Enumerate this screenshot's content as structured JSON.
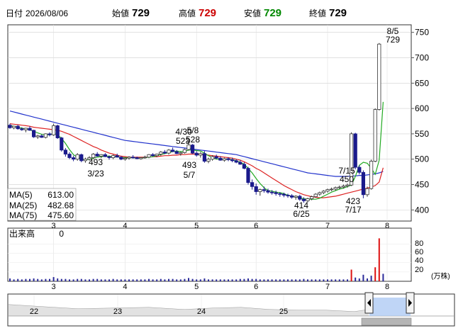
{
  "header": {
    "date_label": "日付",
    "date_value": "2026/08/06",
    "open_label": "始値",
    "open_value": "729",
    "high_label": "高値",
    "high_value": "729",
    "low_label": "安値",
    "low_value": "729",
    "close_label": "終値",
    "close_value": "729"
  },
  "colors": {
    "up": "#ffffff",
    "down": "#1a1a8c",
    "ma5": "#22aa22",
    "ma25": "#dd2222",
    "ma75": "#2233cc",
    "volume": "#2a2a9a",
    "volume_hi": "#dd1111",
    "high_value": "#cc0000",
    "low_value": "#008800"
  },
  "legend": {
    "ma5": "MA(5)",
    "ma5_value": "613.00",
    "ma25": "MA(25)",
    "ma25_value": "482.68",
    "ma75": "MA(75)",
    "ma75_value": "475.60"
  },
  "volume_panel": {
    "label": "出来高",
    "value": "0",
    "unit": "(万株)",
    "ticks": [
      "80",
      "60",
      "40",
      "20"
    ]
  },
  "chart_data": {
    "type": "candlestick",
    "ylim": [
      378,
      765
    ],
    "yticks": [
      400,
      450,
      500,
      550,
      600,
      650,
      700,
      750
    ],
    "xticks": [
      "3",
      "4",
      "5",
      "6",
      "7",
      "8"
    ],
    "navigator_ticks": [
      "22",
      "23",
      "24",
      "25"
    ],
    "annotations": [
      {
        "text": "4/30",
        "value": 535
      },
      {
        "text": "5/8",
        "value": 528
      },
      {
        "text": "523",
        "value": 523
      },
      {
        "text": "528",
        "value": 528
      },
      {
        "text": "493",
        "value": 493
      },
      {
        "text": "3/23",
        "value": 493
      },
      {
        "text": "493",
        "value": 493
      },
      {
        "text": "5/7",
        "value": 493
      },
      {
        "text": "414",
        "value": 414
      },
      {
        "text": "6/25",
        "value": 414
      },
      {
        "text": "7/15",
        "value": 450
      },
      {
        "text": "450",
        "value": 450
      },
      {
        "text": "423",
        "value": 423
      },
      {
        "text": "7/17",
        "value": 423
      },
      {
        "text": "8/5",
        "value": 729
      },
      {
        "text": "729",
        "value": 729
      }
    ],
    "candles": [
      [
        567,
        570,
        560,
        562
      ],
      [
        562,
        566,
        559,
        565
      ],
      [
        565,
        568,
        558,
        560
      ],
      [
        560,
        563,
        556,
        558
      ],
      [
        558,
        562,
        553,
        561
      ],
      [
        561,
        565,
        556,
        557
      ],
      [
        557,
        558,
        542,
        544
      ],
      [
        544,
        548,
        540,
        546
      ],
      [
        546,
        549,
        542,
        543
      ],
      [
        543,
        551,
        541,
        550
      ],
      [
        550,
        553,
        545,
        548
      ],
      [
        548,
        570,
        546,
        566
      ],
      [
        566,
        568,
        540,
        542
      ],
      [
        542,
        544,
        515,
        518
      ],
      [
        518,
        522,
        505,
        510
      ],
      [
        510,
        514,
        500,
        503
      ],
      [
        503,
        507,
        496,
        500
      ],
      [
        500,
        512,
        497,
        509
      ],
      [
        509,
        511,
        494,
        497
      ],
      [
        497,
        503,
        493,
        500
      ],
      [
        500,
        506,
        497,
        503
      ],
      [
        503,
        512,
        500,
        510
      ],
      [
        510,
        514,
        505,
        506
      ],
      [
        506,
        510,
        502,
        509
      ],
      [
        509,
        512,
        504,
        505
      ],
      [
        505,
        507,
        499,
        503
      ],
      [
        503,
        509,
        500,
        507
      ],
      [
        507,
        511,
        503,
        504
      ],
      [
        504,
        506,
        498,
        500
      ],
      [
        500,
        504,
        497,
        502
      ],
      [
        502,
        506,
        499,
        504
      ],
      [
        504,
        508,
        501,
        503
      ],
      [
        503,
        505,
        500,
        501
      ],
      [
        501,
        504,
        499,
        503
      ],
      [
        503,
        507,
        501,
        504
      ],
      [
        504,
        510,
        502,
        509
      ],
      [
        509,
        512,
        505,
        507
      ],
      [
        507,
        511,
        504,
        510
      ],
      [
        510,
        516,
        507,
        514
      ],
      [
        514,
        518,
        510,
        512
      ],
      [
        512,
        520,
        509,
        518
      ],
      [
        518,
        523,
        514,
        515
      ],
      [
        515,
        518,
        510,
        511
      ],
      [
        511,
        515,
        507,
        513
      ],
      [
        513,
        521,
        511,
        519
      ],
      [
        519,
        535,
        517,
        528
      ],
      [
        528,
        530,
        510,
        512
      ],
      [
        512,
        516,
        505,
        508
      ],
      [
        508,
        514,
        503,
        511
      ],
      [
        511,
        516,
        493,
        496
      ],
      [
        496,
        503,
        492,
        500
      ],
      [
        500,
        508,
        497,
        505
      ],
      [
        505,
        509,
        500,
        502
      ],
      [
        502,
        506,
        497,
        498
      ],
      [
        498,
        503,
        495,
        501
      ],
      [
        501,
        504,
        496,
        499
      ],
      [
        499,
        503,
        494,
        497
      ],
      [
        497,
        500,
        492,
        494
      ],
      [
        494,
        498,
        489,
        490
      ],
      [
        490,
        494,
        480,
        482
      ],
      [
        482,
        485,
        450,
        454
      ],
      [
        454,
        460,
        440,
        446
      ],
      [
        446,
        452,
        430,
        436
      ],
      [
        436,
        442,
        428,
        440
      ],
      [
        440,
        446,
        434,
        438
      ],
      [
        438,
        442,
        432,
        435
      ],
      [
        435,
        439,
        430,
        434
      ],
      [
        434,
        438,
        428,
        432
      ],
      [
        432,
        435,
        426,
        431
      ],
      [
        431,
        434,
        425,
        429
      ],
      [
        429,
        432,
        424,
        428
      ],
      [
        428,
        431,
        422,
        425
      ],
      [
        425,
        429,
        420,
        427
      ],
      [
        427,
        430,
        418,
        421
      ],
      [
        421,
        425,
        414,
        418
      ],
      [
        418,
        424,
        415,
        422
      ],
      [
        422,
        428,
        419,
        426
      ],
      [
        426,
        433,
        424,
        431
      ],
      [
        431,
        436,
        428,
        434
      ],
      [
        434,
        439,
        431,
        437
      ],
      [
        437,
        442,
        434,
        440
      ],
      [
        440,
        444,
        437,
        441
      ],
      [
        441,
        446,
        438,
        444
      ],
      [
        444,
        448,
        441,
        445
      ],
      [
        445,
        450,
        442,
        447
      ],
      [
        447,
        452,
        444,
        449
      ],
      [
        449,
        553,
        447,
        550
      ],
      [
        550,
        552,
        480,
        484
      ],
      [
        484,
        488,
        470,
        474
      ],
      [
        474,
        478,
        423,
        430
      ],
      [
        430,
        446,
        426,
        442
      ],
      [
        442,
        499,
        440,
        496
      ],
      [
        496,
        600,
        494,
        598
      ],
      [
        598,
        729,
        596,
        727
      ]
    ],
    "ma5": [
      566,
      565,
      563,
      561,
      560,
      558,
      555,
      552,
      549,
      548,
      548,
      551,
      548,
      541,
      531,
      519,
      509,
      503,
      501,
      499,
      500,
      502,
      504,
      505,
      506,
      506,
      505,
      505,
      503,
      503,
      503,
      503,
      502,
      502,
      503,
      504,
      505,
      507,
      509,
      511,
      513,
      515,
      516,
      515,
      515,
      518,
      518,
      517,
      516,
      512,
      507,
      503,
      500,
      500,
      500,
      500,
      499,
      497,
      494,
      490,
      482,
      473,
      462,
      452,
      444,
      438,
      437,
      435,
      434,
      432,
      429,
      427,
      426,
      424,
      422,
      421,
      421,
      421,
      423,
      427,
      431,
      435,
      438,
      441,
      443,
      446,
      449,
      466,
      488,
      494,
      492,
      482,
      470,
      498,
      613
    ],
    "ma25": [
      570,
      569,
      568,
      567,
      566,
      565,
      563,
      562,
      561,
      560,
      559,
      558,
      557,
      555,
      552,
      549,
      545,
      541,
      537,
      533,
      529,
      525,
      522,
      518,
      515,
      512,
      510,
      508,
      506,
      505,
      504,
      504,
      504,
      504,
      504,
      504,
      505,
      505,
      506,
      507,
      507,
      508,
      508,
      509,
      509,
      510,
      510,
      510,
      510,
      509,
      508,
      507,
      506,
      505,
      504,
      503,
      502,
      500,
      498,
      495,
      491,
      487,
      482,
      478,
      473,
      468,
      463,
      458,
      453,
      448,
      444,
      440,
      436,
      433,
      430,
      428,
      426,
      425,
      424,
      424,
      425,
      426,
      427,
      429,
      431,
      433,
      435,
      437,
      439,
      441,
      443,
      445,
      448,
      455,
      483
    ],
    "ma75": [
      595,
      593,
      591,
      589,
      587,
      585,
      583,
      581,
      579,
      577,
      575,
      573,
      571,
      569,
      567,
      565,
      563,
      561,
      559,
      557,
      555,
      553,
      551,
      549,
      547,
      545,
      543,
      541,
      539,
      537,
      536,
      535,
      534,
      533,
      532,
      531,
      530,
      529,
      528,
      527,
      526,
      525,
      524,
      523,
      522,
      521,
      520,
      519,
      518,
      517,
      516,
      515,
      514,
      513,
      512,
      511,
      510,
      509,
      507,
      505,
      503,
      501,
      499,
      497,
      495,
      493,
      491,
      489,
      487,
      485,
      483,
      481,
      479,
      477,
      475,
      473,
      472,
      471,
      470,
      469,
      468,
      467,
      466,
      466,
      466,
      466,
      467,
      467,
      468,
      468,
      469,
      470,
      471,
      473,
      476
    ],
    "volume": [
      6,
      4,
      5,
      4,
      5,
      5,
      6,
      5,
      4,
      5,
      5,
      9,
      6,
      5,
      5,
      4,
      4,
      5,
      5,
      4,
      4,
      5,
      5,
      4,
      4,
      4,
      5,
      4,
      4,
      4,
      4,
      4,
      4,
      4,
      4,
      5,
      4,
      4,
      5,
      4,
      5,
      5,
      4,
      4,
      5,
      7,
      5,
      4,
      4,
      6,
      4,
      4,
      4,
      4,
      4,
      4,
      4,
      4,
      5,
      5,
      6,
      5,
      5,
      4,
      4,
      4,
      4,
      4,
      4,
      4,
      4,
      4,
      4,
      4,
      5,
      4,
      4,
      4,
      4,
      4,
      4,
      4,
      4,
      4,
      4,
      4,
      25,
      8,
      6,
      14,
      6,
      12,
      30,
      92,
      16
    ]
  }
}
